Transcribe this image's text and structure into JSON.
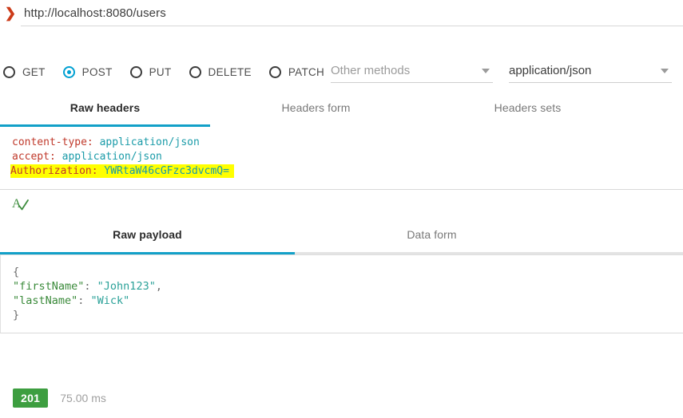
{
  "url_bar": {
    "chevron_icon": "chevron-right-icon",
    "url": "http://localhost:8080/users",
    "placeholder": "http://"
  },
  "methods": {
    "options": [
      {
        "label": "GET",
        "selected": false
      },
      {
        "label": "POST",
        "selected": true
      },
      {
        "label": "PUT",
        "selected": false
      },
      {
        "label": "DELETE",
        "selected": false
      },
      {
        "label": "PATCH",
        "selected": false
      }
    ],
    "other_methods": {
      "value": "",
      "placeholder": "Other methods",
      "caret_icon": "chevron-down-icon"
    },
    "content_type": {
      "value": "application/json",
      "caret_icon": "chevron-down-icon"
    }
  },
  "headers_section": {
    "tabs": [
      {
        "label": "Raw headers",
        "active": true
      },
      {
        "label": "Headers form",
        "active": false
      },
      {
        "label": "Headers sets",
        "active": false
      }
    ],
    "raw_headers": [
      {
        "key": "content-type:",
        "value": "application/json",
        "highlighted": false
      },
      {
        "key": "accept:",
        "value": "application/json",
        "highlighted": false
      },
      {
        "key": "Authorization:",
        "value": "YWRtaW46cGFzc3dvcmQ=",
        "highlighted": true
      }
    ],
    "spellcheck_icon": "spellcheck-icon"
  },
  "payload_section": {
    "tabs": [
      {
        "label": "Raw payload",
        "active": true
      },
      {
        "label": "Data form",
        "active": false
      }
    ],
    "raw_payload_lines": [
      {
        "punct_open": "{",
        "key": "",
        "sep": "",
        "value": "",
        "punct_end": ""
      },
      {
        "punct_open": "",
        "key": "\"firstName\"",
        "sep": ": ",
        "value": "\"John123\"",
        "punct_end": ","
      },
      {
        "punct_open": "",
        "key": "\"lastName\"",
        "sep": ": ",
        "value": "\"Wick\"",
        "punct_end": ""
      },
      {
        "punct_open": "}",
        "key": "",
        "sep": "",
        "value": "",
        "punct_end": ""
      }
    ]
  },
  "status": {
    "code": "201",
    "time": "75.00 ms"
  },
  "colors": {
    "accent": "#12a0c8",
    "radio_selected": "#00a0d2",
    "chevron": "#cc3b19",
    "status_success": "#3d9e40",
    "highlight": "#ffff00",
    "header_key": "#c0392b",
    "header_value": "#1a9ba8",
    "payload_key": "#3a8a3a",
    "payload_value": "#2aa198"
  }
}
